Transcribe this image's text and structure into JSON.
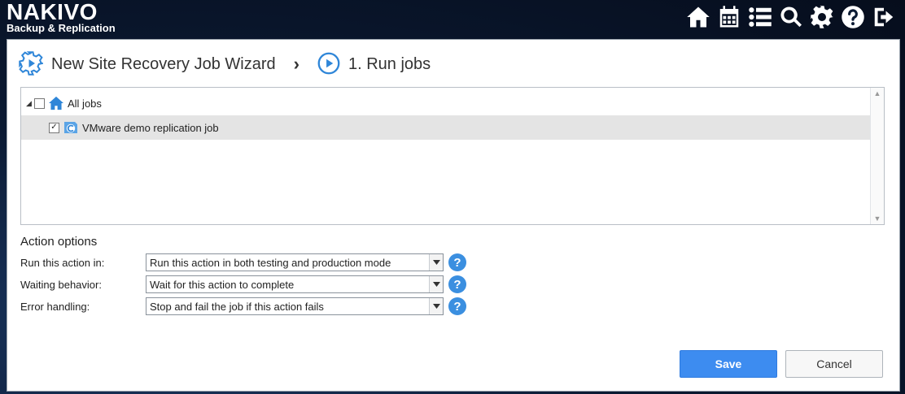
{
  "brand": {
    "name": "NAKIVO",
    "subtitle": "Backup & Replication"
  },
  "nav": [
    {
      "icon": "home-icon"
    },
    {
      "icon": "calendar-icon"
    },
    {
      "icon": "list-icon"
    },
    {
      "icon": "search-icon"
    },
    {
      "icon": "gear-icon"
    },
    {
      "icon": "help-icon"
    },
    {
      "icon": "logout-icon"
    }
  ],
  "wizard": {
    "title": "New Site Recovery Job Wizard",
    "step": "1. Run jobs"
  },
  "tree": {
    "root": {
      "label": "All jobs",
      "checked": false,
      "icon": "home-icon"
    },
    "children": [
      {
        "label": "VMware demo replication job",
        "checked": true,
        "icon": "replication-job-icon"
      }
    ]
  },
  "action_options": {
    "title": "Action options",
    "rows": [
      {
        "label": "Run this action in:",
        "value": "Run this action in both testing and production mode"
      },
      {
        "label": "Waiting behavior:",
        "value": "Wait for this action to complete"
      },
      {
        "label": "Error handling:",
        "value": "Stop and fail the job if this action fails"
      }
    ]
  },
  "buttons": {
    "save": "Save",
    "cancel": "Cancel"
  },
  "colors": {
    "accent": "#3d8cf0",
    "help": "#3b8fe0",
    "selected_row": "#e4e4e4"
  }
}
